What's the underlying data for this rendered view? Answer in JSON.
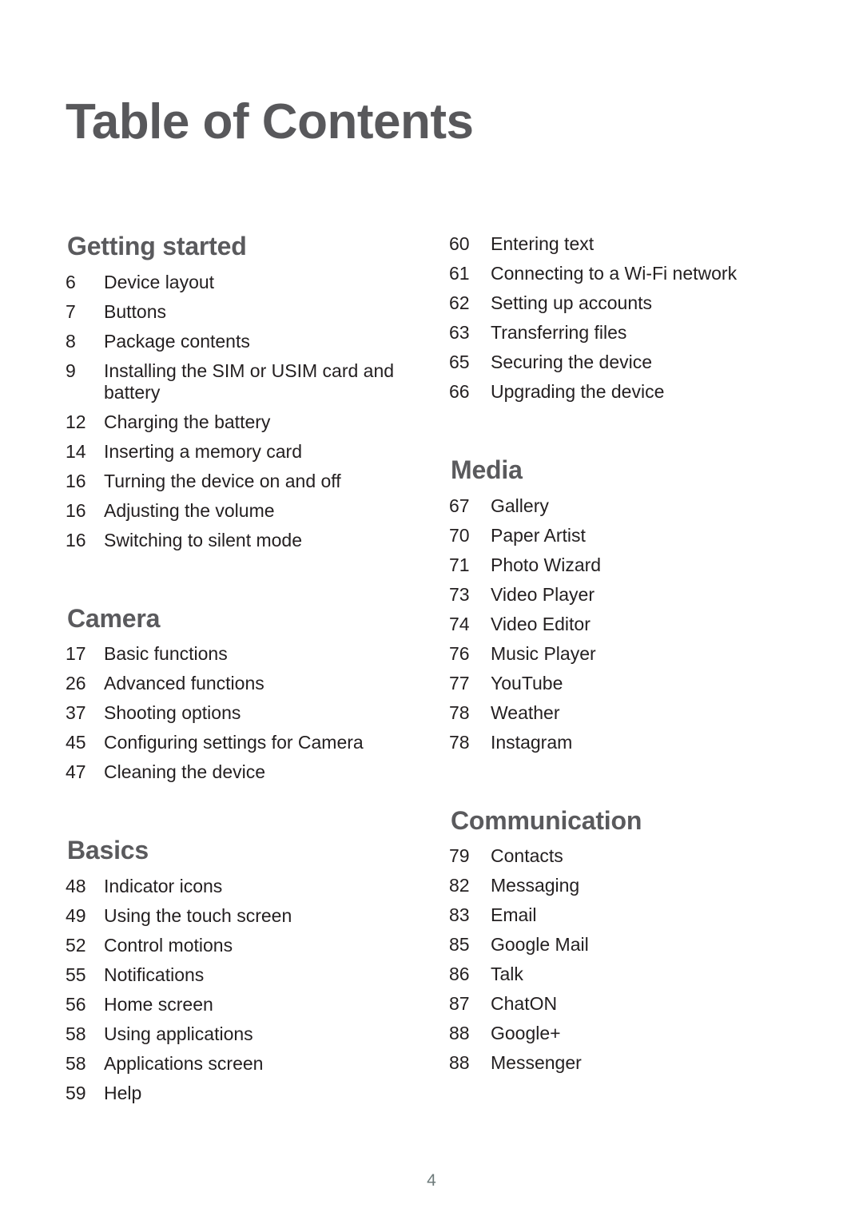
{
  "document": {
    "title": "Table of Contents",
    "page_number": "4",
    "title_color": "#58585b",
    "heading_color": "#5a5a5d",
    "body_color": "#231f20",
    "folio_color": "#6e7b7b",
    "background": "#ffffff"
  },
  "columns": {
    "left": [
      {
        "heading": "Getting started",
        "entries": [
          {
            "page": "6",
            "label": "Device layout"
          },
          {
            "page": "7",
            "label": "Buttons"
          },
          {
            "page": "8",
            "label": "Package contents"
          },
          {
            "page": "9",
            "label": "Installing the SIM or USIM card and battery"
          },
          {
            "page": "12",
            "label": "Charging the battery"
          },
          {
            "page": "14",
            "label": "Inserting a memory card"
          },
          {
            "page": "16",
            "label": "Turning the device on and off"
          },
          {
            "page": "16",
            "label": "Adjusting the volume"
          },
          {
            "page": "16",
            "label": "Switching to silent mode"
          }
        ]
      },
      {
        "heading": "Camera",
        "entries": [
          {
            "page": "17",
            "label": "Basic functions"
          },
          {
            "page": "26",
            "label": "Advanced functions"
          },
          {
            "page": "37",
            "label": "Shooting options"
          },
          {
            "page": "45",
            "label": "Configuring settings for Camera"
          },
          {
            "page": "47",
            "label": "Cleaning the device"
          }
        ]
      },
      {
        "heading": "Basics",
        "entries": [
          {
            "page": "48",
            "label": "Indicator icons"
          },
          {
            "page": "49",
            "label": "Using the touch screen"
          },
          {
            "page": "52",
            "label": "Control motions"
          },
          {
            "page": "55",
            "label": "Notifications"
          },
          {
            "page": "56",
            "label": "Home screen"
          },
          {
            "page": "58",
            "label": "Using applications"
          },
          {
            "page": "58",
            "label": "Applications screen"
          },
          {
            "page": "59",
            "label": "Help"
          }
        ]
      }
    ],
    "right": [
      {
        "heading": "",
        "entries": [
          {
            "page": "60",
            "label": "Entering text"
          },
          {
            "page": "61",
            "label": "Connecting to a Wi-Fi network"
          },
          {
            "page": "62",
            "label": "Setting up accounts"
          },
          {
            "page": "63",
            "label": "Transferring files"
          },
          {
            "page": "65",
            "label": "Securing the device"
          },
          {
            "page": "66",
            "label": "Upgrading the device"
          }
        ]
      },
      {
        "heading": "Media",
        "entries": [
          {
            "page": "67",
            "label": "Gallery"
          },
          {
            "page": "70",
            "label": "Paper Artist"
          },
          {
            "page": "71",
            "label": "Photo Wizard"
          },
          {
            "page": "73",
            "label": "Video Player"
          },
          {
            "page": "74",
            "label": "Video Editor"
          },
          {
            "page": "76",
            "label": "Music Player"
          },
          {
            "page": "77",
            "label": "YouTube"
          },
          {
            "page": "78",
            "label": "Weather"
          },
          {
            "page": "78",
            "label": "Instagram"
          }
        ]
      },
      {
        "heading": "Communication",
        "entries": [
          {
            "page": "79",
            "label": "Contacts"
          },
          {
            "page": "82",
            "label": "Messaging"
          },
          {
            "page": "83",
            "label": "Email"
          },
          {
            "page": "85",
            "label": "Google Mail"
          },
          {
            "page": "86",
            "label": "Talk"
          },
          {
            "page": "87",
            "label": "ChatON"
          },
          {
            "page": "88",
            "label": "Google+"
          },
          {
            "page": "88",
            "label": "Messenger"
          }
        ]
      }
    ]
  }
}
